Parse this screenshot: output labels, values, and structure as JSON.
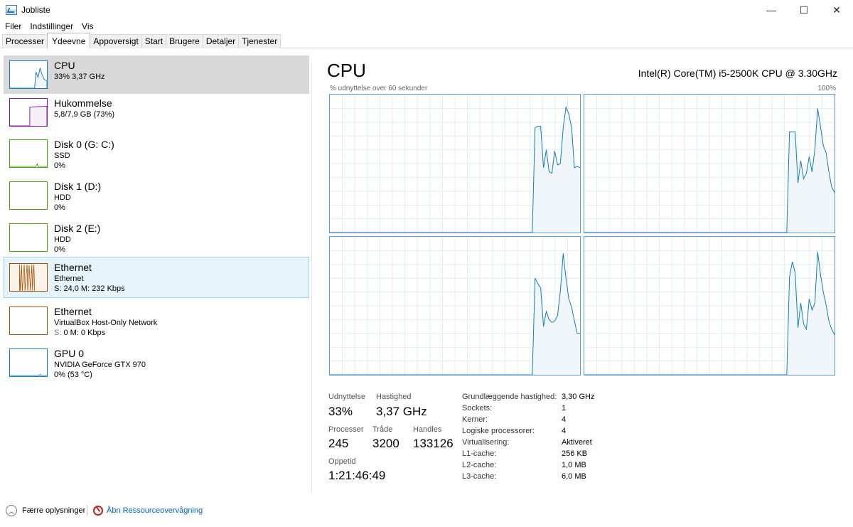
{
  "window": {
    "title": "Jobliste"
  },
  "winbtns": {
    "minimize": "—",
    "maximize": "☐",
    "close": "✕"
  },
  "menu": [
    "Filer",
    "Indstillinger",
    "Vis"
  ],
  "tabs": [
    "Processer",
    "Ydeevne",
    "Appoversigt",
    "Start",
    "Brugere",
    "Detaljer",
    "Tjenester"
  ],
  "sidebar": [
    {
      "name": "CPU",
      "line1": "33% 3,37 GHz",
      "line2": "",
      "color": "#117dbb"
    },
    {
      "name": "Hukommelse",
      "line1": "5,8/7,9 GB (73%)",
      "line2": "",
      "color": "#8b12ae"
    },
    {
      "name": "Disk 0 (G: C:)",
      "line1": "SSD",
      "line2": "0%",
      "color": "#4da60c"
    },
    {
      "name": "Disk 1 (D:)",
      "line1": "HDD",
      "line2": "0%",
      "color": "#4da60c"
    },
    {
      "name": "Disk 2 (E:)",
      "line1": "HDD",
      "line2": "0%",
      "color": "#4da60c"
    },
    {
      "name": "Ethernet",
      "line1": "Ethernet",
      "line2": "S: 24,0 M: 232 Kbps",
      "color": "#a74f01"
    },
    {
      "name": "Ethernet",
      "line1": "VirtualBox Host-Only Network",
      "line2_s": "S:",
      "line2": "0 M: 0 Kbps",
      "color": "#a74f01"
    },
    {
      "name": "GPU 0",
      "line1": "NVIDIA GeForce GTX 970",
      "line2": "0% (53 °C)",
      "color": "#117dbb"
    }
  ],
  "main": {
    "title": "CPU",
    "model": "Intel(R) Core(TM) i5-2500K CPU @ 3.30GHz",
    "axis_left": "% udnyttelse over 60 sekunder",
    "axis_right": "100%",
    "cores": [
      [
        0,
        0,
        0,
        0,
        0,
        0,
        0,
        0,
        0,
        0,
        0,
        0,
        0,
        0,
        0,
        0,
        0,
        0,
        0,
        0,
        0,
        0,
        0,
        0,
        0,
        0,
        0,
        0,
        0,
        0,
        0,
        0,
        0,
        0,
        0,
        0,
        0,
        0,
        0,
        0,
        0,
        0,
        0,
        0,
        0,
        0,
        0,
        0,
        0,
        0,
        0,
        0,
        0,
        0,
        0,
        0,
        0,
        0,
        0,
        0,
        0,
        0,
        0,
        0,
        0,
        0,
        0,
        0,
        0,
        0,
        0,
        0,
        0,
        76,
        77,
        77,
        47,
        60,
        44,
        43,
        59,
        49,
        50,
        76,
        91,
        86,
        76,
        47,
        48,
        47
      ],
      [
        0,
        0,
        0,
        0,
        0,
        0,
        0,
        0,
        0,
        0,
        0,
        0,
        0,
        0,
        0,
        0,
        0,
        0,
        0,
        0,
        0,
        0,
        0,
        0,
        0,
        0,
        0,
        0,
        0,
        0,
        0,
        0,
        0,
        0,
        0,
        0,
        0,
        0,
        0,
        0,
        0,
        0,
        0,
        0,
        0,
        0,
        0,
        0,
        0,
        0,
        0,
        0,
        0,
        0,
        0,
        0,
        0,
        0,
        0,
        0,
        0,
        0,
        0,
        0,
        0,
        0,
        0,
        0,
        0,
        0,
        0,
        0,
        0,
        73,
        73,
        73,
        36,
        52,
        39,
        43,
        55,
        44,
        60,
        90,
        77,
        63,
        58,
        44,
        33,
        29
      ],
      [
        0,
        0,
        0,
        0,
        0,
        0,
        0,
        0,
        0,
        0,
        0,
        0,
        0,
        0,
        0,
        0,
        0,
        0,
        0,
        0,
        0,
        0,
        0,
        0,
        0,
        0,
        0,
        0,
        0,
        0,
        0,
        0,
        0,
        0,
        0,
        0,
        0,
        0,
        0,
        0,
        0,
        0,
        0,
        0,
        0,
        0,
        0,
        0,
        0,
        0,
        0,
        0,
        0,
        0,
        0,
        0,
        0,
        0,
        0,
        0,
        0,
        0,
        0,
        0,
        0,
        0,
        0,
        0,
        0,
        0,
        0,
        0,
        0,
        70,
        66,
        63,
        35,
        46,
        40,
        38,
        39,
        43,
        61,
        88,
        70,
        55,
        49,
        39,
        30,
        30
      ],
      [
        0,
        0,
        0,
        0,
        0,
        0,
        0,
        0,
        0,
        0,
        0,
        0,
        0,
        0,
        0,
        0,
        0,
        0,
        0,
        0,
        0,
        0,
        0,
        0,
        0,
        0,
        0,
        0,
        0,
        0,
        0,
        0,
        0,
        0,
        0,
        0,
        0,
        0,
        0,
        0,
        0,
        0,
        0,
        0,
        0,
        0,
        0,
        0,
        0,
        0,
        0,
        0,
        0,
        0,
        0,
        0,
        0,
        0,
        0,
        0,
        0,
        0,
        0,
        0,
        0,
        0,
        0,
        0,
        0,
        0,
        0,
        0,
        0,
        71,
        82,
        74,
        34,
        52,
        37,
        33,
        55,
        47,
        52,
        89,
        73,
        60,
        51,
        39,
        33,
        29
      ]
    ],
    "stats": {
      "udnyttelse_label": "Udnyttelse",
      "udnyttelse": "33%",
      "hastighed_label": "Hastighed",
      "hastighed": "3,37 GHz",
      "processer_label": "Processer",
      "processer": "245",
      "traade_label": "Tråde",
      "traade": "3200",
      "handles_label": "Handles",
      "handles": "133126",
      "oppetid_label": "Oppetid",
      "oppetid": "1:21:46:49"
    },
    "specs": [
      [
        "Grundlæggende hastighed:",
        "3,30 GHz"
      ],
      [
        "Sockets:",
        "1"
      ],
      [
        "Kerner:",
        "4"
      ],
      [
        "Logiske processorer:",
        "4"
      ],
      [
        "Virtualisering:",
        "Aktiveret"
      ],
      [
        "L1-cache:",
        "256 KB"
      ],
      [
        "L2-cache:",
        "1,0 MB"
      ],
      [
        "L3-cache:",
        "6,0 MB"
      ]
    ]
  },
  "footer": {
    "fewer": "Færre oplysninger",
    "resmon": "Åbn Ressourceovervågning"
  },
  "colors": {
    "cpu_line": "#117dbb",
    "cpu_fill": "#f1f6fa",
    "grid": "#d9eaf4"
  }
}
